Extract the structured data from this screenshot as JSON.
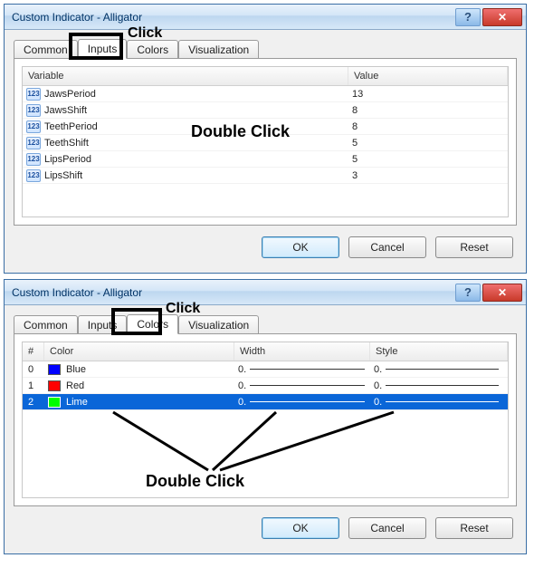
{
  "dialog1": {
    "title": "Custom Indicator - Alligator",
    "tabs": [
      "Common",
      "Inputs",
      "Colors",
      "Visualization"
    ],
    "active_tab": "Inputs",
    "columns": {
      "variable": "Variable",
      "value": "Value"
    },
    "rows": [
      {
        "name": "JawsPeriod",
        "value": "13"
      },
      {
        "name": "JawsShift",
        "value": "8"
      },
      {
        "name": "TeethPeriod",
        "value": "8"
      },
      {
        "name": "TeethShift",
        "value": "5"
      },
      {
        "name": "LipsPeriod",
        "value": "5"
      },
      {
        "name": "LipsShift",
        "value": "3"
      }
    ],
    "buttons": {
      "ok": "OK",
      "cancel": "Cancel",
      "reset": "Reset"
    }
  },
  "dialog2": {
    "title": "Custom Indicator - Alligator",
    "tabs": [
      "Common",
      "Inputs",
      "Colors",
      "Visualization"
    ],
    "active_tab": "Colors",
    "columns": {
      "num": "#",
      "color": "Color",
      "width": "Width",
      "style": "Style"
    },
    "rows": [
      {
        "index": "0",
        "color_name": "Blue",
        "swatch": "#0000ff",
        "width": "0.",
        "style": "0."
      },
      {
        "index": "1",
        "color_name": "Red",
        "swatch": "#ff0000",
        "width": "0.",
        "style": "0."
      },
      {
        "index": "2",
        "color_name": "Lime",
        "swatch": "#00ff00",
        "width": "0.",
        "style": "0.",
        "selected": true
      }
    ],
    "buttons": {
      "ok": "OK",
      "cancel": "Cancel",
      "reset": "Reset"
    }
  },
  "annotations": {
    "click1": "Click",
    "double_click1": "Double Click",
    "click2": "Click",
    "double_click2": "Double Click"
  },
  "icons": {
    "help": "?",
    "close": "✕",
    "intlabel": "123"
  }
}
